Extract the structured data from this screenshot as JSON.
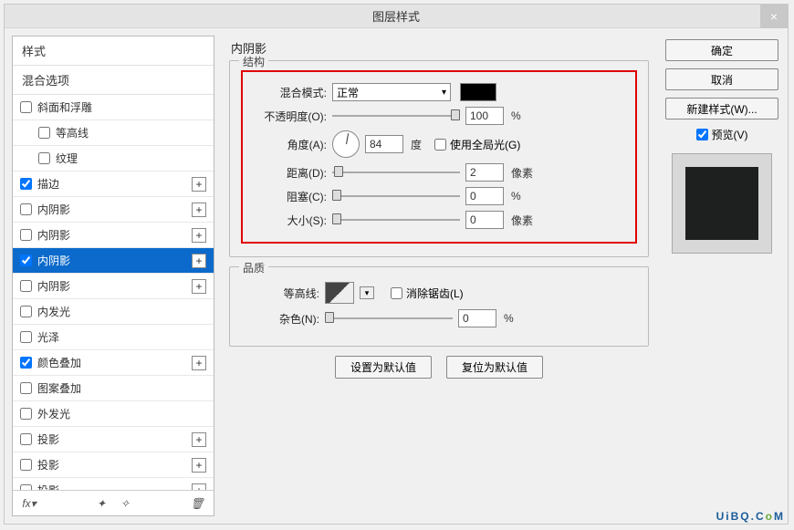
{
  "dialog": {
    "title": "图层样式",
    "close": "×"
  },
  "sidebar": {
    "header": "样式",
    "blend_options": "混合选项",
    "items": [
      {
        "label": "斜面和浮雕",
        "checked": false,
        "plus": false
      },
      {
        "label": "等高线",
        "checked": false,
        "plus": false,
        "indent": true
      },
      {
        "label": "纹理",
        "checked": false,
        "plus": false,
        "indent": true
      },
      {
        "label": "描边",
        "checked": true,
        "plus": true
      },
      {
        "label": "内阴影",
        "checked": false,
        "plus": true
      },
      {
        "label": "内阴影",
        "checked": false,
        "plus": true
      },
      {
        "label": "内阴影",
        "checked": true,
        "plus": true,
        "selected": true
      },
      {
        "label": "内阴影",
        "checked": false,
        "plus": true
      },
      {
        "label": "内发光",
        "checked": false,
        "plus": false
      },
      {
        "label": "光泽",
        "checked": false,
        "plus": false
      },
      {
        "label": "颜色叠加",
        "checked": true,
        "plus": true
      },
      {
        "label": "图案叠加",
        "checked": false,
        "plus": false
      },
      {
        "label": "外发光",
        "checked": false,
        "plus": false
      },
      {
        "label": "投影",
        "checked": false,
        "plus": true
      },
      {
        "label": "投影",
        "checked": false,
        "plus": true
      },
      {
        "label": "投影",
        "checked": false,
        "plus": true
      }
    ],
    "plus_symbol": "+"
  },
  "center": {
    "title": "内阴影",
    "structure": {
      "legend": "结构",
      "blend_mode_label": "混合模式:",
      "blend_mode_value": "正常",
      "opacity_label": "不透明度(O):",
      "opacity_value": "100",
      "opacity_unit": "%",
      "angle_label": "角度(A):",
      "angle_value": "84",
      "angle_unit": "度",
      "global_light": "使用全局光(G)",
      "distance_label": "距离(D):",
      "distance_value": "2",
      "distance_unit": "像素",
      "choke_label": "阻塞(C):",
      "choke_value": "0",
      "choke_unit": "%",
      "size_label": "大小(S):",
      "size_value": "0",
      "size_unit": "像素"
    },
    "quality": {
      "legend": "品质",
      "contour_label": "等高线:",
      "antialias": "消除锯齿(L)",
      "noise_label": "杂色(N):",
      "noise_value": "0",
      "noise_unit": "%"
    },
    "buttons": {
      "set_default": "设置为默认值",
      "reset_default": "复位为默认值"
    }
  },
  "right": {
    "ok": "确定",
    "cancel": "取消",
    "new_style": "新建样式(W)...",
    "preview": "预览(V)"
  },
  "watermark": "UiBQ.CoM"
}
